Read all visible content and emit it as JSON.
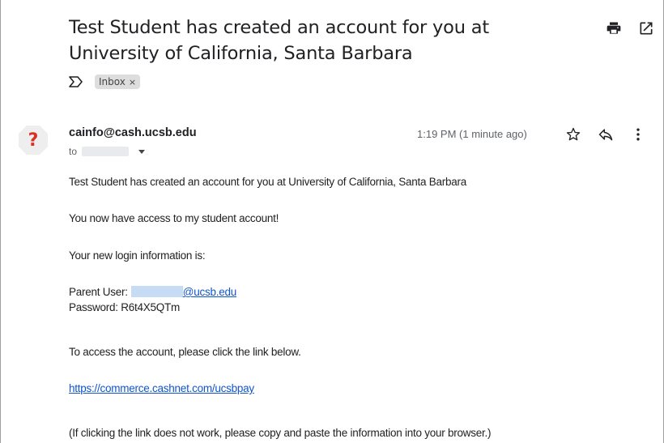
{
  "email": {
    "subject": "Test Student has created an account for you at University of California, Santa Barbara",
    "label_chip": "Inbox",
    "label_chip_close": "×",
    "sender": "cainfo@cash.ucsb.edu",
    "to_prefix": "to",
    "timestamp": "1:19 PM (1 minute ago)",
    "avatar_glyph": "?",
    "body": {
      "line1": "Test Student has created an account for you at University of California, Santa Barbara",
      "line2": "You now have access to my student account!",
      "line3": "Your new login information is:",
      "parent_user_label": "Parent User:",
      "parent_user_domain": "@ucsb.edu",
      "password_line": "Password: R6t4X5QTm",
      "line6": "To access the account, please click the link below.",
      "link": "https://commerce.cashnet.com/ucsbpay",
      "line8": "(If clicking the link does not work, please copy and paste the information into your browser.)"
    }
  },
  "icons": {
    "print": "print-icon",
    "open_new_window": "open-in-new-window-icon",
    "label_arrow": "label-important-icon",
    "star": "star-icon",
    "reply": "reply-icon",
    "more": "more-vert-icon",
    "caret": "chevron-down-icon",
    "avatar": "unknown-sender-avatar"
  },
  "colors": {
    "link": "#1155cc",
    "avatar_bg": "#eeeeee",
    "avatar_glyph": "#d93025",
    "chip_bg": "#dddddd"
  }
}
